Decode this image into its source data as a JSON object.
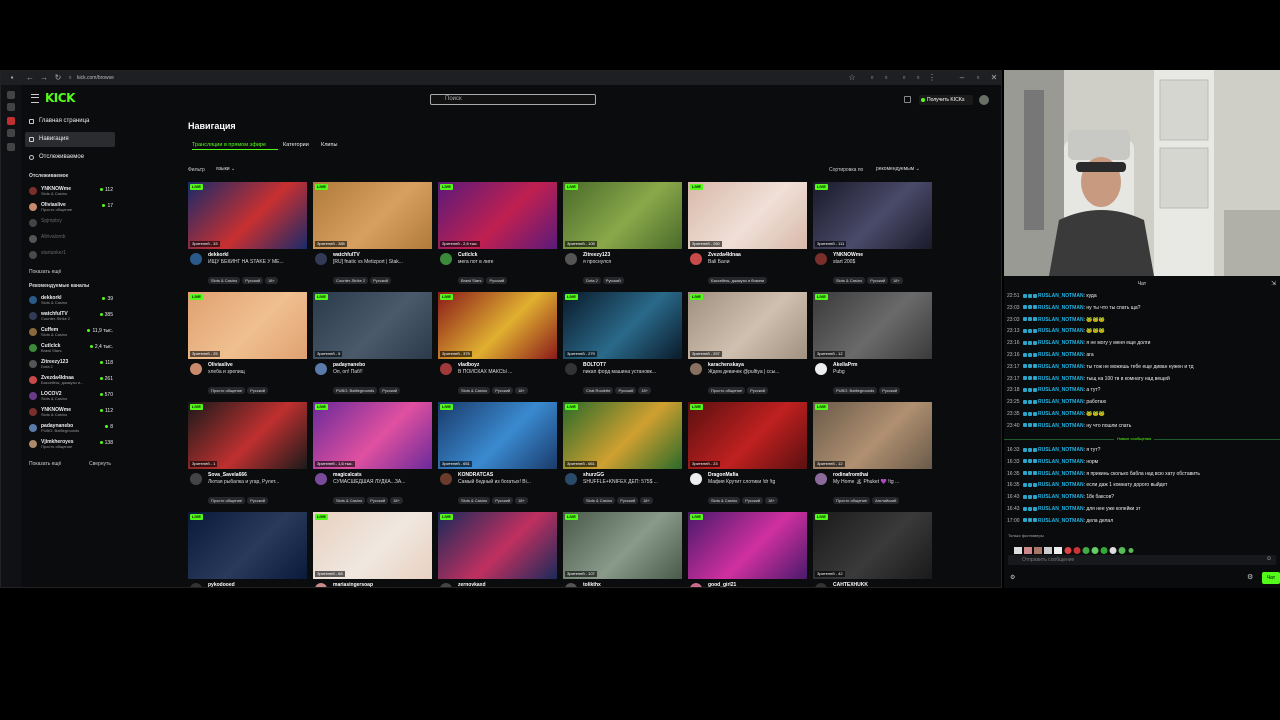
{
  "browser": {
    "url": "kick.com/browse"
  },
  "header": {
    "logo": "KICK",
    "search_placeholder": "Поиск",
    "get_kicks": "Получить KICKs"
  },
  "sidebar": {
    "nav": [
      "Главная страница",
      "Навигация",
      "Отслеживаемое"
    ],
    "following_title": "Отслеживаемое",
    "following": [
      {
        "name": "YNKNOWme",
        "cat": "Slots & Casino",
        "v": "112",
        "color": "#7a2f2a"
      },
      {
        "name": "Oliviaslive",
        "cat": "Просто общение",
        "v": "17",
        "color": "#c88a6a"
      },
      {
        "name": "Spjmptoy",
        "cat": "",
        "v": "",
        "color": "#444"
      },
      {
        "name": "Allrivalomb",
        "cat": "",
        "v": "",
        "color": "#555"
      },
      {
        "name": "startanker1",
        "cat": "",
        "v": "",
        "color": "#4a4a4a"
      }
    ],
    "show_more": "Показать ещё",
    "recommended_title": "Рекомендуемые каналы",
    "recommended": [
      {
        "name": "dekkorkl",
        "cat": "Slots & Casino",
        "v": "39",
        "color": "#2a5a8a"
      },
      {
        "name": "watchfulTV",
        "cat": "Counter-Strike 2",
        "v": "385",
        "color": "#333a55"
      },
      {
        "name": "Cuffem",
        "cat": "Slots & Casino",
        "v": "11,9 тыс.",
        "color": "#8a6a3a"
      },
      {
        "name": "Cutlclck",
        "cat": "Brawl Stars",
        "v": "2,4 тыс.",
        "color": "#3a8a3a"
      },
      {
        "name": "Zitreezy123",
        "cat": "Dota 2",
        "v": "118",
        "color": "#555"
      },
      {
        "name": "Zvezda4ldnaa",
        "cat": "Бассейны, джакузи и...",
        "v": "261",
        "color": "#c84a4a"
      },
      {
        "name": "LOCOV2",
        "cat": "Slots & Casino",
        "v": "570",
        "color": "#6a3a8a"
      },
      {
        "name": "YNKNOWme",
        "cat": "Slots & Casino",
        "v": "112",
        "color": "#7a2f2a"
      },
      {
        "name": "padaynanebo",
        "cat": "PUBG: Battlegrounds",
        "v": "8",
        "color": "#5a7aaa"
      },
      {
        "name": "Vjimkheroyes",
        "cat": "Просто общение",
        "v": "138",
        "color": "#aa8a6a"
      }
    ],
    "show_more2": "Показать ещё",
    "collapse": "Свернуть"
  },
  "main": {
    "title": "Навигация",
    "tabs": [
      "Трансляции в прямом эфире",
      "Категории",
      "Клипы"
    ],
    "filter_label": "Фильтр",
    "filter_value": "языки",
    "sort_label": "Сортировка по",
    "sort_value": "рекомендуемым",
    "live": "LIVE",
    "cards": [
      {
        "viewers": "Зрителей - 33",
        "name": "dekkorkl",
        "title": "ИЩУ БЕКИНГ НА STAKE У МЕ...",
        "tags": [
          "Slots & Casino",
          "Русский",
          "18+"
        ],
        "c1": "#1a2a6a",
        "c2": "#c83030",
        "av": "#2a5a8a"
      },
      {
        "viewers": "Зрителей - 385",
        "name": "watchfulTV",
        "title": "[RU] fnatic vs Metizport | Stak...",
        "tags": [
          "Counter-Strike 2",
          "Русский"
        ],
        "c1": "#b07a3a",
        "c2": "#d8a060",
        "av": "#333a55"
      },
      {
        "viewers": "Зрителей - 2,6 тыс.",
        "name": "Cutlclck",
        "title": "мега пот в лиге",
        "tags": [
          "Brawl Stars",
          "Русский"
        ],
        "c1": "#5a1a7a",
        "c2": "#c02050",
        "av": "#3a8a3a"
      },
      {
        "viewers": "Зрителей - 105",
        "name": "Zitreezy123",
        "title": "я проснулся",
        "tags": [
          "Dota 2",
          "Русский"
        ],
        "c1": "#4a6a2a",
        "c2": "#8aa84a",
        "av": "#555"
      },
      {
        "viewers": "Зрителей - 260",
        "name": "Zvezda4ldnaa",
        "title": "Bali Бали",
        "tags": [
          "Бассейны, джакузи и бикини"
        ],
        "c1": "#d8b8a8",
        "c2": "#f0e0d8",
        "av": "#c84a4a"
      },
      {
        "viewers": "Зрителей - 111",
        "name": "YNKNOWme",
        "title": "start 200$",
        "tags": [
          "Slots & Casino",
          "Русский",
          "18+"
        ],
        "c1": "#1a1a2a",
        "c2": "#4a4a6a",
        "av": "#7a2f2a"
      },
      {
        "viewers": "Зрителей - 25",
        "name": "Oliviaslive",
        "title": "хлеба и зрелищ",
        "tags": [
          "Просто общение",
          "Русский"
        ],
        "c1": "#e0a070",
        "c2": "#f0c090",
        "av": "#c88a6a"
      },
      {
        "viewers": "Зрителей - 5",
        "name": "padaynanebo",
        "title": "Оп, оп! Паб!!",
        "tags": [
          "PUBG: Battlegrounds",
          "Русский"
        ],
        "c1": "#2a3a4a",
        "c2": "#4a5a6a",
        "av": "#5a7aaa"
      },
      {
        "viewers": "Зрителей - 379",
        "name": "vladboyz",
        "title": "В ПОИСКАХ МАКСЫ ...",
        "tags": [
          "Slots & Casino",
          "Русский",
          "18+"
        ],
        "c1": "#8a1a1a",
        "c2": "#e0b030",
        "av": "#a03a3a"
      },
      {
        "viewers": "Зрителей - 279",
        "name": "BOLTOT7",
        "title": "пикап форд машина установк...",
        "tags": [
          "Chat Roulette",
          "Русский",
          "18+"
        ],
        "c1": "#0a1a2a",
        "c2": "#2a6a8a",
        "av": "#333"
      },
      {
        "viewers": "Зрителей - 297",
        "name": "karachenskaya",
        "title": "Ждем девачек @pultiya | ссы...",
        "tags": [
          "Просто общение",
          "Русский"
        ],
        "c1": "#a09080",
        "c2": "#d0c0b0",
        "av": "#8a7060"
      },
      {
        "viewers": "Зрителей - 12",
        "name": "AkellaPrm",
        "title": "Pubg",
        "tags": [
          "PUBG: Battlegrounds",
          "Русский"
        ],
        "c1": "#3a3a3a",
        "c2": "#6a6a6a",
        "av": "#eee"
      },
      {
        "viewers": "Зрителей - 1",
        "name": "Sova_Savela666",
        "title": "Лютая рыбалка и угар, Рулет...",
        "tags": [
          "Просто общение",
          "Русский"
        ],
        "c1": "#1a1a1a",
        "c2": "#c03030",
        "av": "#444"
      },
      {
        "viewers": "Зрителей - 1,6 тыс.",
        "name": "magicalcats",
        "title": "СУМАСШЕДШАЯ ЛУДКА...ЗА...",
        "tags": [
          "Slots & Casino",
          "Русский",
          "18+"
        ],
        "c1": "#6a2a9a",
        "c2": "#e050a0",
        "av": "#7a4a9a"
      },
      {
        "viewers": "Зрителей - 651",
        "name": "KONDRATCAS",
        "title": "Самый бедный из богатых! Bi...",
        "tags": [
          "Slots & Casino",
          "Русский",
          "18+"
        ],
        "c1": "#1a3a6a",
        "c2": "#3a8ad0",
        "av": "#6a3a2a"
      },
      {
        "viewers": "Зрителей - 661",
        "name": "shurzGG",
        "title": "SHUFFLE+KNIFEX ДЕП: 575$ ...",
        "tags": [
          "Slots & Casino",
          "Русский",
          "18+"
        ],
        "c1": "#2a6a2a",
        "c2": "#d0a030",
        "av": "#2a4a6a"
      },
      {
        "viewers": "Зрителей - 23",
        "name": "DragonMafia",
        "title": "Мафия Крутит слотики !dr !tg",
        "tags": [
          "Slots & Casino",
          "Русский",
          "18+"
        ],
        "c1": "#5a1010",
        "c2": "#c02020",
        "av": "#eee"
      },
      {
        "viewers": "Зрителей - 12",
        "name": "rodinafromthai",
        "title": "My Home 🏝 Phuket 💜 !tg ...",
        "tags": [
          "Просто общение",
          "Английский"
        ],
        "c1": "#6a5a4a",
        "c2": "#b09070",
        "av": "#8a6a9a"
      },
      {
        "viewers": "",
        "name": "pykodooed",
        "title": "",
        "tags": [],
        "c1": "#0a1a3a",
        "c2": "#2a3a5a",
        "av": "#333"
      },
      {
        "viewers": "Зрителей - 68",
        "name": "mariasingersoap",
        "title": "",
        "tags": [],
        "c1": "#e8d0c0",
        "c2": "#f0e8e0",
        "av": "#c88a8a"
      },
      {
        "viewers": "",
        "name": "zernovkaxd",
        "title": "",
        "tags": [],
        "c1": "#1a2a5a",
        "c2": "#c03060",
        "av": "#444"
      },
      {
        "viewers": "Зрителей - 107",
        "name": "tolikthx",
        "title": "",
        "tags": [],
        "c1": "#4a5a4a",
        "c2": "#8a9a8a",
        "av": "#555"
      },
      {
        "viewers": "",
        "name": "good_girl21",
        "title": "",
        "tags": [],
        "c1": "#4a1a6a",
        "c2": "#d030a0",
        "av": "#c86a8a"
      },
      {
        "viewers": "Зрителей - 42",
        "name": "CAHTEXHUKK",
        "title": "",
        "tags": [],
        "c1": "#1a1a1a",
        "c2": "#3a3a3a",
        "av": "#333"
      }
    ]
  },
  "chat": {
    "title": "Чат",
    "messages": [
      {
        "t": "22:51",
        "u": "RUSLAN_NOTMAN",
        "m": "куда"
      },
      {
        "t": "23:03",
        "u": "RUSLAN_NOTMAN",
        "m": "ну ты что ты спать ща?"
      },
      {
        "t": "23:03",
        "u": "RUSLAN_NOTMAN",
        "m": "🐸🐸🐸"
      },
      {
        "t": "23:13",
        "u": "RUSLAN_NOTMAN",
        "m": "🐸🐸🐸"
      },
      {
        "t": "23:16",
        "u": "RUSLAN_NOTMAN",
        "m": "я не могу у меня еще долги"
      },
      {
        "t": "23:16",
        "u": "RUSLAN_NOTMAN",
        "m": "ага"
      },
      {
        "t": "23:17",
        "u": "RUSLAN_NOTMAN",
        "m": "ты тож не можешь тебе еще диван нужен и тд"
      },
      {
        "t": "23:17",
        "u": "RUSLAN_NOTMAN",
        "m": "тыщ на 100 тв в комнату над вещей"
      },
      {
        "t": "23:18",
        "u": "RUSLAN_NOTMAN",
        "m": "а тут?"
      },
      {
        "t": "23:25",
        "u": "RUSLAN_NOTMAN",
        "m": "работаю"
      },
      {
        "t": "23:35",
        "u": "RUSLAN_NOTMAN",
        "m": "🐸🐸🐸"
      },
      {
        "t": "23:40",
        "u": "RUSLAN_NOTMAN",
        "m": "ну что пошли спать"
      },
      {
        "t": "16:33",
        "u": "RUSLAN_NOTMAN",
        "m": "я тут?"
      },
      {
        "t": "16:33",
        "u": "RUSLAN_NOTMAN",
        "m": "норм"
      },
      {
        "t": "16:35",
        "u": "RUSLAN_NOTMAN",
        "m": "я прикинь сколько бабла над всю хату обставить"
      },
      {
        "t": "16:35",
        "u": "RUSLAN_NOTMAN",
        "m": "если даж 1 комнату дорого выйдет"
      },
      {
        "t": "16:43",
        "u": "RUSLAN_NOTMAN",
        "m": "18к баксов?"
      },
      {
        "t": "16:43",
        "u": "RUSLAN_NOTMAN",
        "m": "для нее уже копейки эт"
      },
      {
        "t": "17:00",
        "u": "RUSLAN_NOTMAN",
        "m": "дела делал"
      }
    ],
    "new_messages": "Новые сообщения",
    "followers_only": "Только фолловеры",
    "input_placeholder": "Отправить сообщение",
    "send": "Чат"
  }
}
